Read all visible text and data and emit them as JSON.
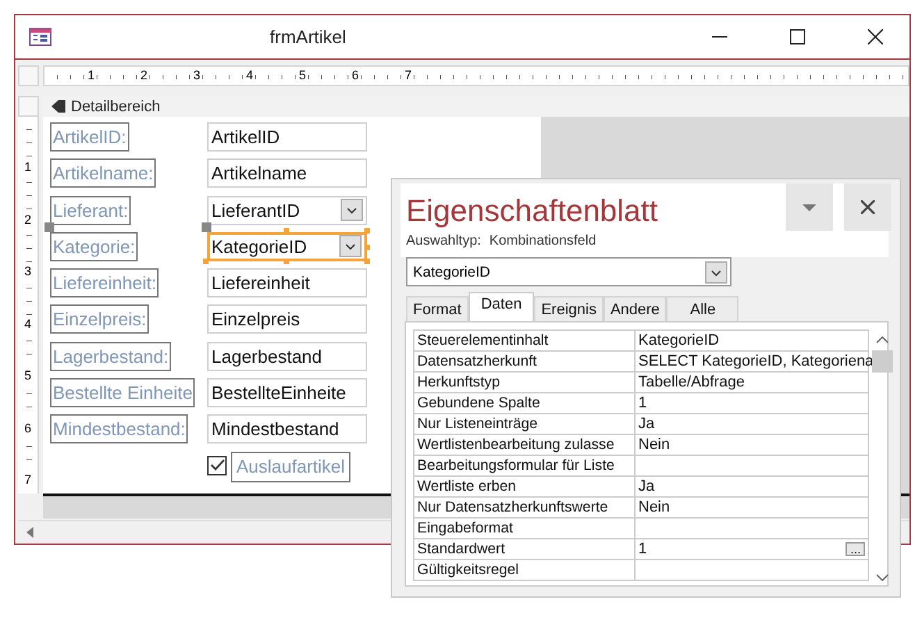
{
  "form_window": {
    "title": "frmArtikel",
    "ruler_h": [
      "1",
      "2",
      "3",
      "4",
      "5",
      "6",
      "7"
    ],
    "ruler_v": [
      "1",
      "2",
      "3",
      "4",
      "5",
      "6",
      "7"
    ],
    "section": "Detailbereich",
    "controls": [
      {
        "kind": "text",
        "label": "ArtikelID:",
        "source": "ArtikelID",
        "selected": false
      },
      {
        "kind": "text",
        "label": "Artikelname:",
        "source": "Artikelname",
        "selected": false
      },
      {
        "kind": "combo",
        "label": "Lieferant:",
        "source": "LieferantID",
        "selected": false
      },
      {
        "kind": "combo",
        "label": "Kategorie:",
        "source": "KategorieID",
        "selected": true
      },
      {
        "kind": "text",
        "label": "Liefereinheit:",
        "source": "Liefereinheit",
        "selected": false
      },
      {
        "kind": "text",
        "label": "Einzelpreis:",
        "source": "Einzelpreis",
        "selected": false
      },
      {
        "kind": "text",
        "label": "Lagerbestand:",
        "source": "Lagerbestand",
        "selected": false
      },
      {
        "kind": "text",
        "label": "Bestellte Einheite",
        "source": "BestellteEinheite",
        "selected": false
      },
      {
        "kind": "text",
        "label": "Mindestbestand:",
        "source": "Mindestbestand",
        "selected": false
      },
      {
        "kind": "checkbox",
        "label": "Auslaufartikel",
        "checked": true,
        "selected": false
      }
    ]
  },
  "property_sheet": {
    "title": "Eigenschaftenblatt",
    "selection_type_label": "Auswahltyp:",
    "selection_type": "Kombinationsfeld",
    "object": "KategorieID",
    "tabs": [
      {
        "label": "Format",
        "selected": false
      },
      {
        "label": "Daten",
        "selected": true
      },
      {
        "label": "Ereignis",
        "selected": false
      },
      {
        "label": "Andere",
        "selected": false
      },
      {
        "label": "Alle",
        "selected": false
      }
    ],
    "properties": [
      {
        "name": "Steuerelementinhalt",
        "value": "KategorieID"
      },
      {
        "name": "Datensatzherkunft",
        "value": "SELECT KategorieID, Kategoriena"
      },
      {
        "name": "Herkunftstyp",
        "value": "Tabelle/Abfrage"
      },
      {
        "name": "Gebundene Spalte",
        "value": "1"
      },
      {
        "name": "Nur Listeneinträge",
        "value": "Ja"
      },
      {
        "name": "Wertlistenbearbeitung zulasse",
        "value": "Nein"
      },
      {
        "name": "Bearbeitungsformular für Liste"
      },
      {
        "name": "Wertliste erben",
        "value": "Ja"
      },
      {
        "name": "Nur Datensatzherkunftswerte",
        "value": "Nein"
      },
      {
        "name": "Eingabeformat"
      },
      {
        "name": "Standardwert",
        "value": "1",
        "builder": "..."
      },
      {
        "name": "Gültigkeitsregel"
      }
    ]
  }
}
